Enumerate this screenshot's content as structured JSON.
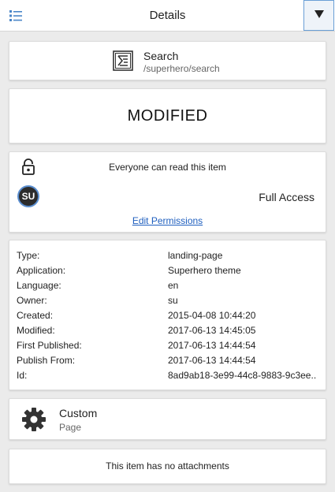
{
  "header": {
    "title": "Details",
    "list_icon": "list-icon",
    "toggle_icon": "triangle-down-icon",
    "accent_color": "#4a86c8"
  },
  "search": {
    "title": "Search",
    "path": "/superhero/search",
    "icon": "search-page-icon"
  },
  "status": {
    "label": "MODIFIED"
  },
  "permissions": {
    "read_text": "Everyone can read this item",
    "lock_icon": "lock-icon",
    "user_initials": "SU",
    "access_level": "Full Access",
    "edit_link": "Edit Permissions"
  },
  "info": {
    "rows": [
      {
        "key": "Type:",
        "value": "landing-page"
      },
      {
        "key": "Application:",
        "value": "Superhero theme"
      },
      {
        "key": "Language:",
        "value": "en"
      },
      {
        "key": "Owner:",
        "value": "su"
      },
      {
        "key": "Created:",
        "value": "2015-04-08 10:44:20"
      },
      {
        "key": "Modified:",
        "value": "2017-06-13 14:45:05"
      },
      {
        "key": "First Published:",
        "value": "2017-06-13 14:44:54"
      },
      {
        "key": "Publish From:",
        "value": "2017-06-13 14:44:54"
      },
      {
        "key": "Id:",
        "value": "8ad9ab18-3e99-44c8-9883-9c3ee.."
      }
    ]
  },
  "content_type": {
    "name": "Custom",
    "kind": "Page",
    "icon": "gear-icon"
  },
  "attachments": {
    "text": "This item has no attachments"
  }
}
